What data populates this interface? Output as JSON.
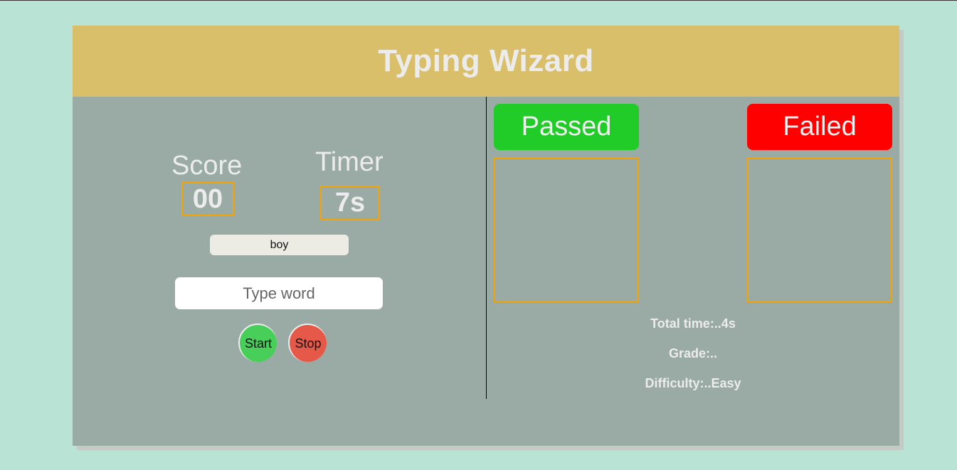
{
  "header": {
    "title": "Typing Wizard"
  },
  "game": {
    "score_label": "Score",
    "score_value": "00",
    "timer_label": "Timer",
    "timer_value": "7s",
    "current_word": "boy",
    "input_placeholder": "Type word",
    "start_label": "Start",
    "stop_label": "Stop"
  },
  "results": {
    "passed_label": "Passed",
    "failed_label": "Failed",
    "total_time": "Total time:..4s",
    "grade": "Grade:..",
    "difficulty": "Difficulty:..Easy"
  },
  "colors": {
    "background": "#b8e3d5",
    "header": "#d9bf6a",
    "panel": "#9aaaa4",
    "passed": "#22cc28",
    "failed": "#ff0000",
    "start": "#48cf5a",
    "stop": "#e65848",
    "accent_border": "#f5a300"
  }
}
